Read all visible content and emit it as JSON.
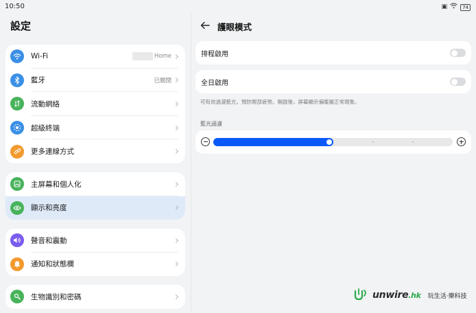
{
  "status_bar": {
    "time": "10:50",
    "battery": "74"
  },
  "left": {
    "title": "設定",
    "groups": [
      [
        {
          "label": "Wi-Fi",
          "value": "Home",
          "icon": "wifi-icon",
          "color": "#3b8fe6"
        },
        {
          "label": "藍牙",
          "value": "已關閉",
          "icon": "bluetooth-icon",
          "color": "#3b8fe6"
        },
        {
          "label": "流動網絡",
          "value": "",
          "icon": "mobile-network-icon",
          "color": "#49b35c"
        },
        {
          "label": "超級終端",
          "value": "",
          "icon": "super-device-icon",
          "color": "#3b8fe6"
        },
        {
          "label": "更多連線方式",
          "value": "",
          "icon": "link-icon",
          "color": "#f29a2e"
        }
      ],
      [
        {
          "label": "主屏幕和個人化",
          "value": "",
          "icon": "home-screen-icon",
          "color": "#49b35c"
        },
        {
          "label": "顯示和亮度",
          "value": "",
          "icon": "display-eye-icon",
          "color": "#49b35c",
          "active": true
        }
      ],
      [
        {
          "label": "聲音和震動",
          "value": "",
          "icon": "sound-icon",
          "color": "#7a5cf0"
        },
        {
          "label": "通知和狀態欄",
          "value": "",
          "icon": "bell-icon",
          "color": "#f29a2e"
        }
      ],
      [
        {
          "label": "生物識別和密碼",
          "value": "",
          "icon": "key-icon",
          "color": "#49b35c"
        }
      ]
    ]
  },
  "right": {
    "title": "護眼模式",
    "scheduled_label": "排程啟用",
    "all_day_label": "全日啟用",
    "description": "可有效過濾藍光，預防眼部疲勞。開啟後，屏幕顯示偏暖屬正常現象。",
    "blue_light_label": "藍光過濾",
    "blue_light_level": 0.5,
    "scheduled_on": false,
    "all_day_on": false
  },
  "watermark": {
    "logo": "unwire",
    "logo_suffix": ".hk",
    "tagline": "玩生活·樂科技"
  },
  "colors": {
    "accent": "#0a59f7",
    "active_row": "#dfeaf8"
  }
}
